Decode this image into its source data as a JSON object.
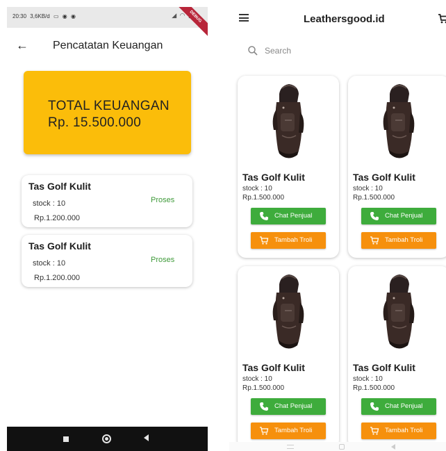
{
  "left_screen": {
    "status_bar": {
      "time": "20:30",
      "speed": "3,6KB/d",
      "system_icons": [
        "screen-icon",
        "notification-icon",
        "notification-icon"
      ],
      "right_icons": [
        "signal-icon",
        "wifi-icon",
        "battery-icon"
      ],
      "ribbon": "DEBUG"
    },
    "app_bar": {
      "back_icon": "arrow-left-icon",
      "title": "Pencatatan Keuangan"
    },
    "total_card": {
      "title": "TOTAL KEUANGAN",
      "amount": "Rp. 15.500.000",
      "color": "#fbbd0a"
    },
    "transactions": [
      {
        "name": "Tas Golf Kulit",
        "stock": "stock : 10",
        "price": "Rp.1.200.000",
        "status": "Proses"
      },
      {
        "name": "Tas Golf Kulit",
        "stock": "stock : 10",
        "price": "Rp.1.200.000",
        "status": "Proses"
      }
    ],
    "status_color": "#3f9a3a",
    "nav_bar": [
      "recent-apps-icon",
      "home-icon",
      "back-icon"
    ]
  },
  "right_screen": {
    "header": {
      "menu_icon": "hamburger-menu-icon",
      "title": "Leathersgood.id",
      "cart_icon": "shopping-cart-icon"
    },
    "search": {
      "placeholder": "Search",
      "icon": "search-icon"
    },
    "products": [
      {
        "name": "Tas Golf Kulit",
        "stock": "stock : 10",
        "price": "Rp.1.500.000",
        "chat_label": "Chat Penjual",
        "troli_label": "Tambah Troli"
      },
      {
        "name": "Tas Golf Kulit",
        "stock": "stock : 10",
        "price": "Rp.1.500.000",
        "chat_label": "Chat Penjual",
        "troli_label": "Tambah Troli"
      },
      {
        "name": "Tas Golf Kulit",
        "stock": "stock : 10",
        "price": "Rp.1.500.000",
        "chat_label": "Chat Penjual",
        "troli_label": "Tambah Troli"
      },
      {
        "name": "Tas Golf Kulit",
        "stock": "stock : 10",
        "price": "Rp.1.500.000",
        "chat_label": "Chat Penjual",
        "troli_label": "Tambah Troli"
      }
    ],
    "button_colors": {
      "chat": "#3eac3c",
      "troli": "#f6900d"
    },
    "gesture_bar": [
      "menu-icon",
      "home-icon",
      "back-icon"
    ]
  }
}
